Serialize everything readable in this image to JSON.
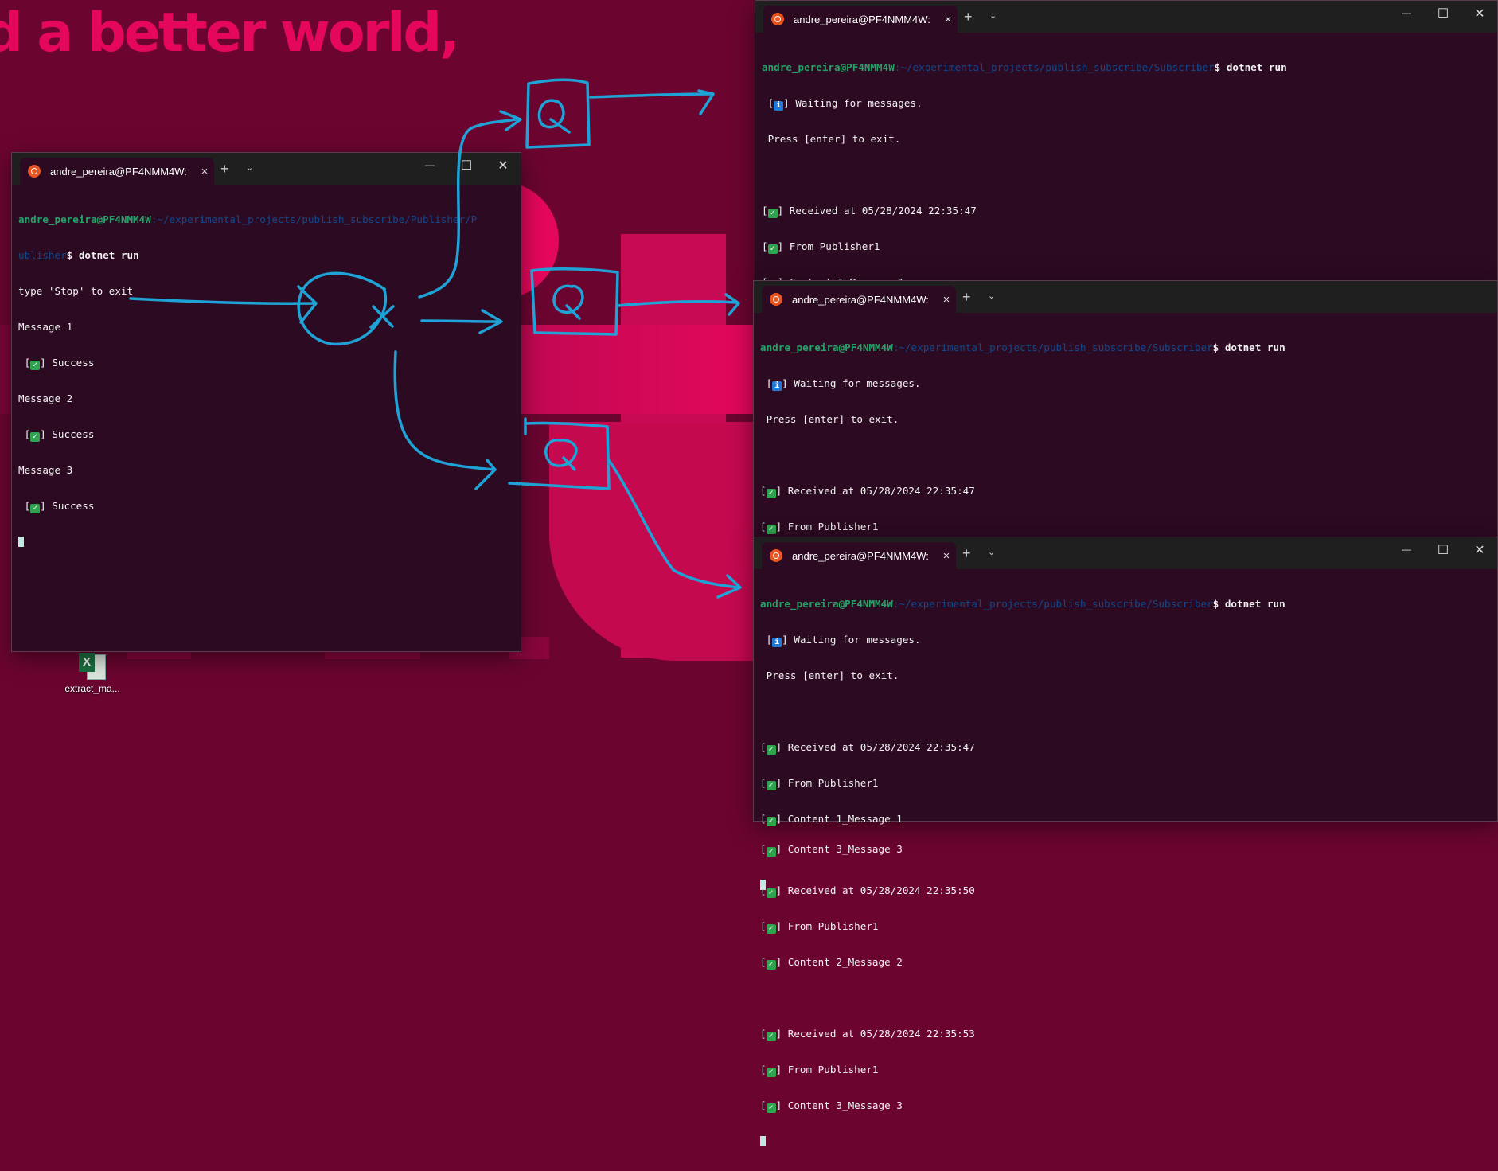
{
  "wallpaper": {
    "headline": "d a better world,"
  },
  "desktop": {
    "icon_label": "extract_ma...",
    "icon_glyph": "X"
  },
  "publisher": {
    "tab_title": "andre_pereira@PF4NMM4W:",
    "prompt_user": "andre_pereira@PF4NMM4W",
    "prompt_path_1": ":~/experimental_projects/publish_subscribe/Publisher/P",
    "prompt_path_2": "ublisher",
    "command": "$ dotnet run",
    "line_stop": "type 'Stop' to exit",
    "msg1": "Message 1",
    "msg2": "Message 2",
    "msg3": "Message 3",
    "success": " Success"
  },
  "subscriber": {
    "tab_title": "andre_pereira@PF4NMM4W:",
    "prompt_user": "andre_pereira@PF4NMM4W",
    "prompt_path": ":~/experimental_projects/publish_subscribe/Subscriber",
    "command": "$ dotnet run",
    "waiting": " Waiting for messages.",
    "press_enter": " Press [enter] to exit.",
    "recv1": " Received at 05/28/2024 22:35:47",
    "recv2": " Received at 05/28/2024 22:35:50",
    "recv3": " Received at 05/28/2024 22:35:53",
    "from": " From Publisher1",
    "content1": " Content 1_Message 1",
    "content2": " Content 2_Message 2",
    "content3": " Content 3_Message 3"
  },
  "icons": {
    "tab_icon": "ubuntu-icon",
    "close": "×",
    "new_tab": "+",
    "dropdown": "⌄",
    "minimize": "—",
    "maximize": "☐",
    "window_close": "✕",
    "check": "✓",
    "info": "i"
  },
  "colors": {
    "wallpaper": "#6b0530",
    "accent": "#e5075c",
    "terminal_bg": "#2c0a22",
    "titlebar": "#1f1f1f",
    "annotation": "#1fa2d6"
  }
}
